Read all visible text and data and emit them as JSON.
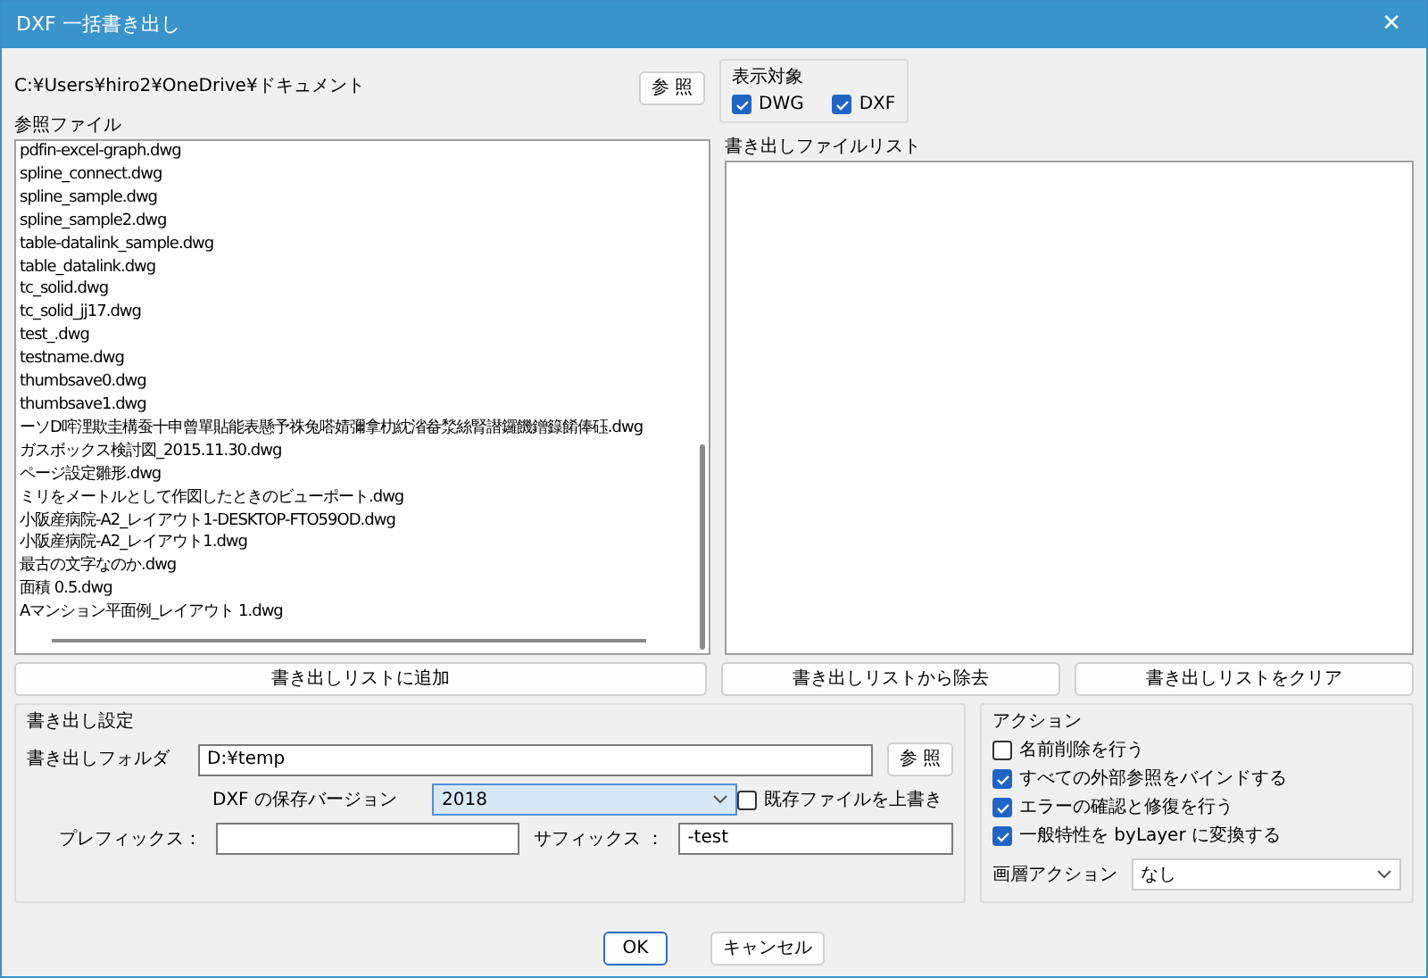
{
  "window": {
    "title": "DXF 一括書き出し",
    "close": "✕"
  },
  "folder_path": "C:¥Users¥hiro2¥OneDrive¥ドキュメント",
  "browse_button": "参 照",
  "display_target": {
    "label": "表示対象",
    "options": [
      {
        "label": "DWG",
        "checked": true
      },
      {
        "label": "DXF",
        "checked": true
      }
    ]
  },
  "reference_files": {
    "label": "参照ファイル",
    "items": [
      "pdfin-excel-graph.dwg",
      "spline_connect.dwg",
      "spline_sample.dwg",
      "spline_sample2.dwg",
      "table-datalink_sample.dwg",
      "table_datalink.dwg",
      "tc_solid.dwg",
      "tc_solid_jj17.dwg",
      "test_.dwg",
      "testname.dwg",
      "thumbsave0.dwg",
      "thumbsave1.dwg",
      "ーソD哰浬欺圭構蚕十申曾單貼能表懸予祩兔嗒婧彌拿朸紞渻畚湬絲腎譛鑼饑鏳籙餚俸砡.dwg",
      "ガスボックス検討図_2015.11.30.dwg",
      "ページ設定雛形.dwg",
      "ミリをメートルとして作図したときのビューポート.dwg",
      "小阪産病院-A2_レイアウト1-DESKTOP-FTO59OD.dwg",
      "小阪産病院-A2_レイアウト1.dwg",
      "最古の文字なのか.dwg",
      "面積 0.5.dwg",
      "Aマンション平面例_レイアウト 1.dwg"
    ]
  },
  "export_list": {
    "label": "書き出しファイルリスト"
  },
  "list_buttons": [
    "書き出しリストに追加",
    "書き出しリストから除去",
    "書き出しリストをクリア"
  ],
  "export_settings": {
    "label": "書き出し設定",
    "folder_label": "書き出しフォルダ",
    "folder_value": "D:¥temp",
    "browse_button": "参 照",
    "version_label": "DXF の保存バージョン",
    "version_value": "2018",
    "overwrite": {
      "label": "既存ファイルを上書き",
      "checked": false
    },
    "prefix_label": "プレフィックス：",
    "suffix_label": "サフィックス ：",
    "suffix_value": "-test"
  },
  "actions": {
    "label": "アクション",
    "options": [
      {
        "label": "名前削除を行う",
        "checked": false
      },
      {
        "label": "すべての外部参照をバインドする",
        "checked": true
      },
      {
        "label": "エラーの確認と修復を行う",
        "checked": true
      },
      {
        "label": "一般特性を byLayer に変換する",
        "checked": true
      }
    ],
    "layer_action_label": "画層アクション",
    "layer_action_value": "なし"
  },
  "ok_button": "OK",
  "cancel_button": "キャンセル"
}
